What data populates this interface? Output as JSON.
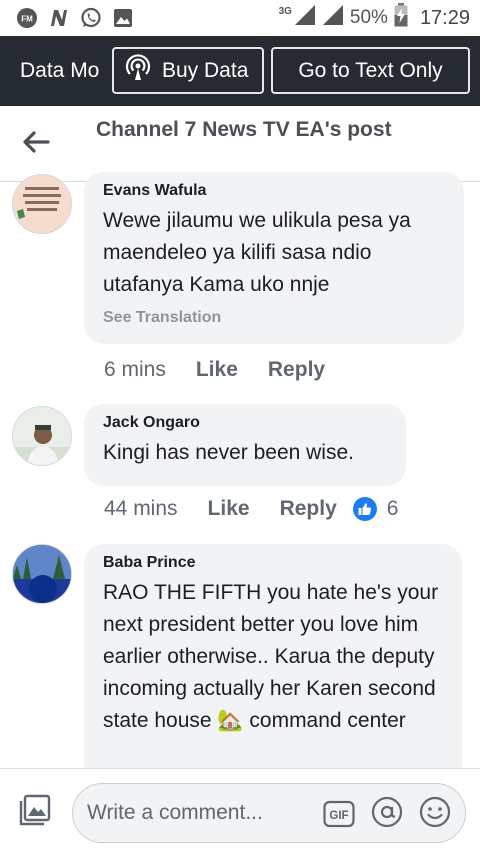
{
  "status_bar": {
    "network_type": "3G",
    "battery_percent": "50%",
    "time": "17:29",
    "left_icons": [
      "fm-radio-icon",
      "n-app-icon",
      "whatsapp-icon",
      "gallery-icon"
    ]
  },
  "data_banner": {
    "mode_label": "Data Mo",
    "buy_data_label": "Buy Data",
    "text_only_label": "Go to Text Only"
  },
  "header": {
    "title": "Channel 7 News TV EA's post"
  },
  "comments": [
    {
      "author": "Evans Wafula",
      "text": "Wewe jilaumu we ulikula pesa ya maendeleo ya kilifi sasa ndio utafanya  Kama uko nnje",
      "see_translation": "See Translation",
      "time": "6 mins",
      "like_label": "Like",
      "reply_label": "Reply",
      "avatar_text": "Luther said, \"Good works do not make a good man but a good man does good works.\""
    },
    {
      "author": "Jack Ongaro",
      "text": "Kingi has never been wise.",
      "time": "44 mins",
      "like_label": "Like",
      "reply_label": "Reply",
      "reaction_count": "6"
    },
    {
      "author": "Baba Prince",
      "text": "RAO THE FIFTH you hate he's your next president better you love him earlier otherwise.. Karua the deputy incoming actually her Karen second state house 🏡 command center"
    }
  ],
  "composer": {
    "placeholder": "Write a comment...",
    "gif_label": "GIF"
  },
  "colors": {
    "banner_bg": "#262b32",
    "bubble_bg": "#f2f3f5",
    "like_blue": "#1d7df0",
    "meta_text": "#606770"
  }
}
